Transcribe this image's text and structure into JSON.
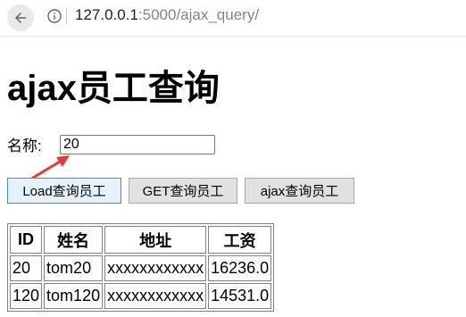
{
  "browser": {
    "url_host": "127.0.0.1",
    "url_rest": ":5000/ajax_query/"
  },
  "page": {
    "title": "ajax员工查询"
  },
  "form": {
    "name_label": "名称:",
    "name_value": "20"
  },
  "buttons": {
    "load_label": "Load查询员工",
    "get_label": "GET查询员工",
    "ajax_label": "ajax查询员工"
  },
  "table": {
    "headers": [
      "ID",
      "姓名",
      "地址",
      "工资"
    ],
    "rows": [
      [
        "20",
        "tom20",
        "xxxxxxxxxxxx",
        "16236.0"
      ],
      [
        "120",
        "tom120",
        "xxxxxxxxxxxx",
        "14531.0"
      ]
    ]
  },
  "colors": {
    "annotation_arrow": "#e53935",
    "focused_button_border": "#3c8fd4"
  }
}
